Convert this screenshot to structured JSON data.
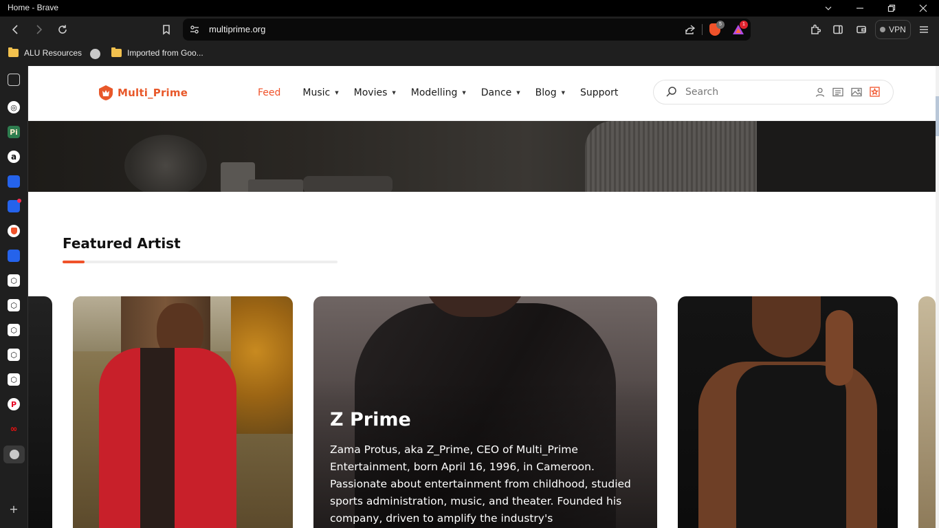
{
  "window": {
    "title": "Home - Brave"
  },
  "browser": {
    "url": "multiprime.org",
    "brave_badge": "5",
    "rewards_badge": "1",
    "vpn_label": "VPN",
    "bookmarks": [
      {
        "label": "ALU Resources",
        "icon": "folder-icon"
      },
      {
        "label": "",
        "icon": "globe-icon"
      },
      {
        "label": "Imported from Goo...",
        "icon": "folder-icon"
      }
    ]
  },
  "sidebar": {
    "items": [
      {
        "icon": "sidebar-panel-icon",
        "glyph": ""
      },
      {
        "icon": "chatgpt-icon",
        "glyph": ""
      },
      {
        "icon": "pi-icon",
        "glyph": "Pi"
      },
      {
        "icon": "amazon-icon",
        "glyph": "a"
      },
      {
        "icon": "flag-icon",
        "glyph": ""
      },
      {
        "icon": "flag-notify-icon",
        "glyph": ""
      },
      {
        "icon": "brave-talk-icon",
        "glyph": ""
      },
      {
        "icon": "flag-icon-2",
        "glyph": ""
      },
      {
        "icon": "cube-icon",
        "glyph": ""
      },
      {
        "icon": "cube-icon-2",
        "glyph": ""
      },
      {
        "icon": "cube-icon-3",
        "glyph": ""
      },
      {
        "icon": "cube-icon-4",
        "glyph": ""
      },
      {
        "icon": "cube-icon-5",
        "glyph": ""
      },
      {
        "icon": "pinterest-icon",
        "glyph": "P"
      },
      {
        "icon": "loop-icon",
        "glyph": ""
      },
      {
        "icon": "globe-icon",
        "glyph": ""
      },
      {
        "icon": "add-icon",
        "glyph": "+"
      }
    ]
  },
  "site": {
    "logo_text": "Multi_Prime",
    "nav": [
      {
        "label": "Feed",
        "active": true,
        "dropdown": false
      },
      {
        "label": "Music",
        "active": false,
        "dropdown": true
      },
      {
        "label": "Movies",
        "active": false,
        "dropdown": true
      },
      {
        "label": "Modelling",
        "active": false,
        "dropdown": true
      },
      {
        "label": "Dance",
        "active": false,
        "dropdown": true
      },
      {
        "label": "Blog",
        "active": false,
        "dropdown": true
      },
      {
        "label": "Support",
        "active": false,
        "dropdown": false
      }
    ],
    "search_placeholder": "Search",
    "accent": "#f0522a"
  },
  "featured": {
    "title": "Featured Artist",
    "main_card": {
      "name": "Z Prime",
      "description": "Zama Protus, aka Z_Prime, CEO of Multi_Prime Entertainment, born April 16, 1996, in Cameroon. Passionate about entertainment from childhood, studied sports administration, music, and theater. Founded his company, driven to amplify the industry's"
    }
  }
}
